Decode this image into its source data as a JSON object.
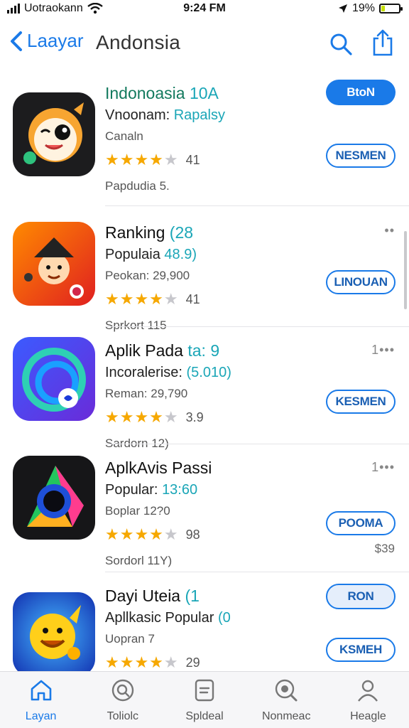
{
  "status": {
    "carrier": "Uotraokann",
    "time": "9:24 FM",
    "battery": "19%",
    "battery_level": 0.19
  },
  "nav": {
    "back_label": "Laayar",
    "title": "Andonsia"
  },
  "apps": [
    {
      "title": "Indonoasia",
      "title_accent": "10A",
      "subtitle": "Vnoonam:",
      "subtitle_accent": "Rapalsy",
      "meta": "Canaln",
      "stars": 4,
      "rating": "41",
      "footer": "Papdudia 5.",
      "button": "BtoN",
      "more": "",
      "extra": ""
    },
    {
      "title": "Ranking",
      "title_accent": "(28",
      "subtitle": "Populaia",
      "subtitle_accent": "48.9)",
      "meta": "Peokan: 29,900",
      "stars": 4,
      "rating": "41",
      "footer": "Sprkort 115",
      "button": "LINOUAN",
      "more": "••",
      "extra": ""
    },
    {
      "title": "Aplik Pada",
      "title_accent": "ta: 9",
      "subtitle": "Incoralerise:",
      "subtitle_accent": "(5.010)",
      "meta": "Reman: 29,790",
      "stars": 4,
      "rating": "3.9",
      "footer": "Sardorn 12)",
      "button": "KESMEN",
      "more": "1•••",
      "extra": ""
    },
    {
      "title": "AplkAvis Passi",
      "title_accent": "",
      "subtitle": "Popular:",
      "subtitle_accent": "13:60",
      "meta": "Boplar 12?0",
      "stars": 4,
      "rating": "98",
      "footer": "Sordorl 11Y)",
      "button": "POOMA",
      "more": "1•••",
      "extra": "$39"
    },
    {
      "title": "Dayi Uteia",
      "title_accent": "(1",
      "subtitle": "Apllkasic Popular",
      "subtitle_accent": "(0",
      "meta": "Uopran 7",
      "stars": 4,
      "rating": "29",
      "footer": "",
      "button": "RON",
      "button2": "KSMEH",
      "more": "",
      "extra": ""
    }
  ],
  "tabs": [
    {
      "label": "Layan",
      "icon": "home-icon"
    },
    {
      "label": "Toliolc",
      "icon": "search-circle-icon"
    },
    {
      "label": "Spldeal",
      "icon": "document-icon"
    },
    {
      "label": "Nonmeac",
      "icon": "magnifier-icon"
    },
    {
      "label": "Heagle",
      "icon": "person-icon"
    }
  ],
  "colors": {
    "accent": "#1a7ae8",
    "teal": "#1aa6b7",
    "star": "#f6a800"
  }
}
